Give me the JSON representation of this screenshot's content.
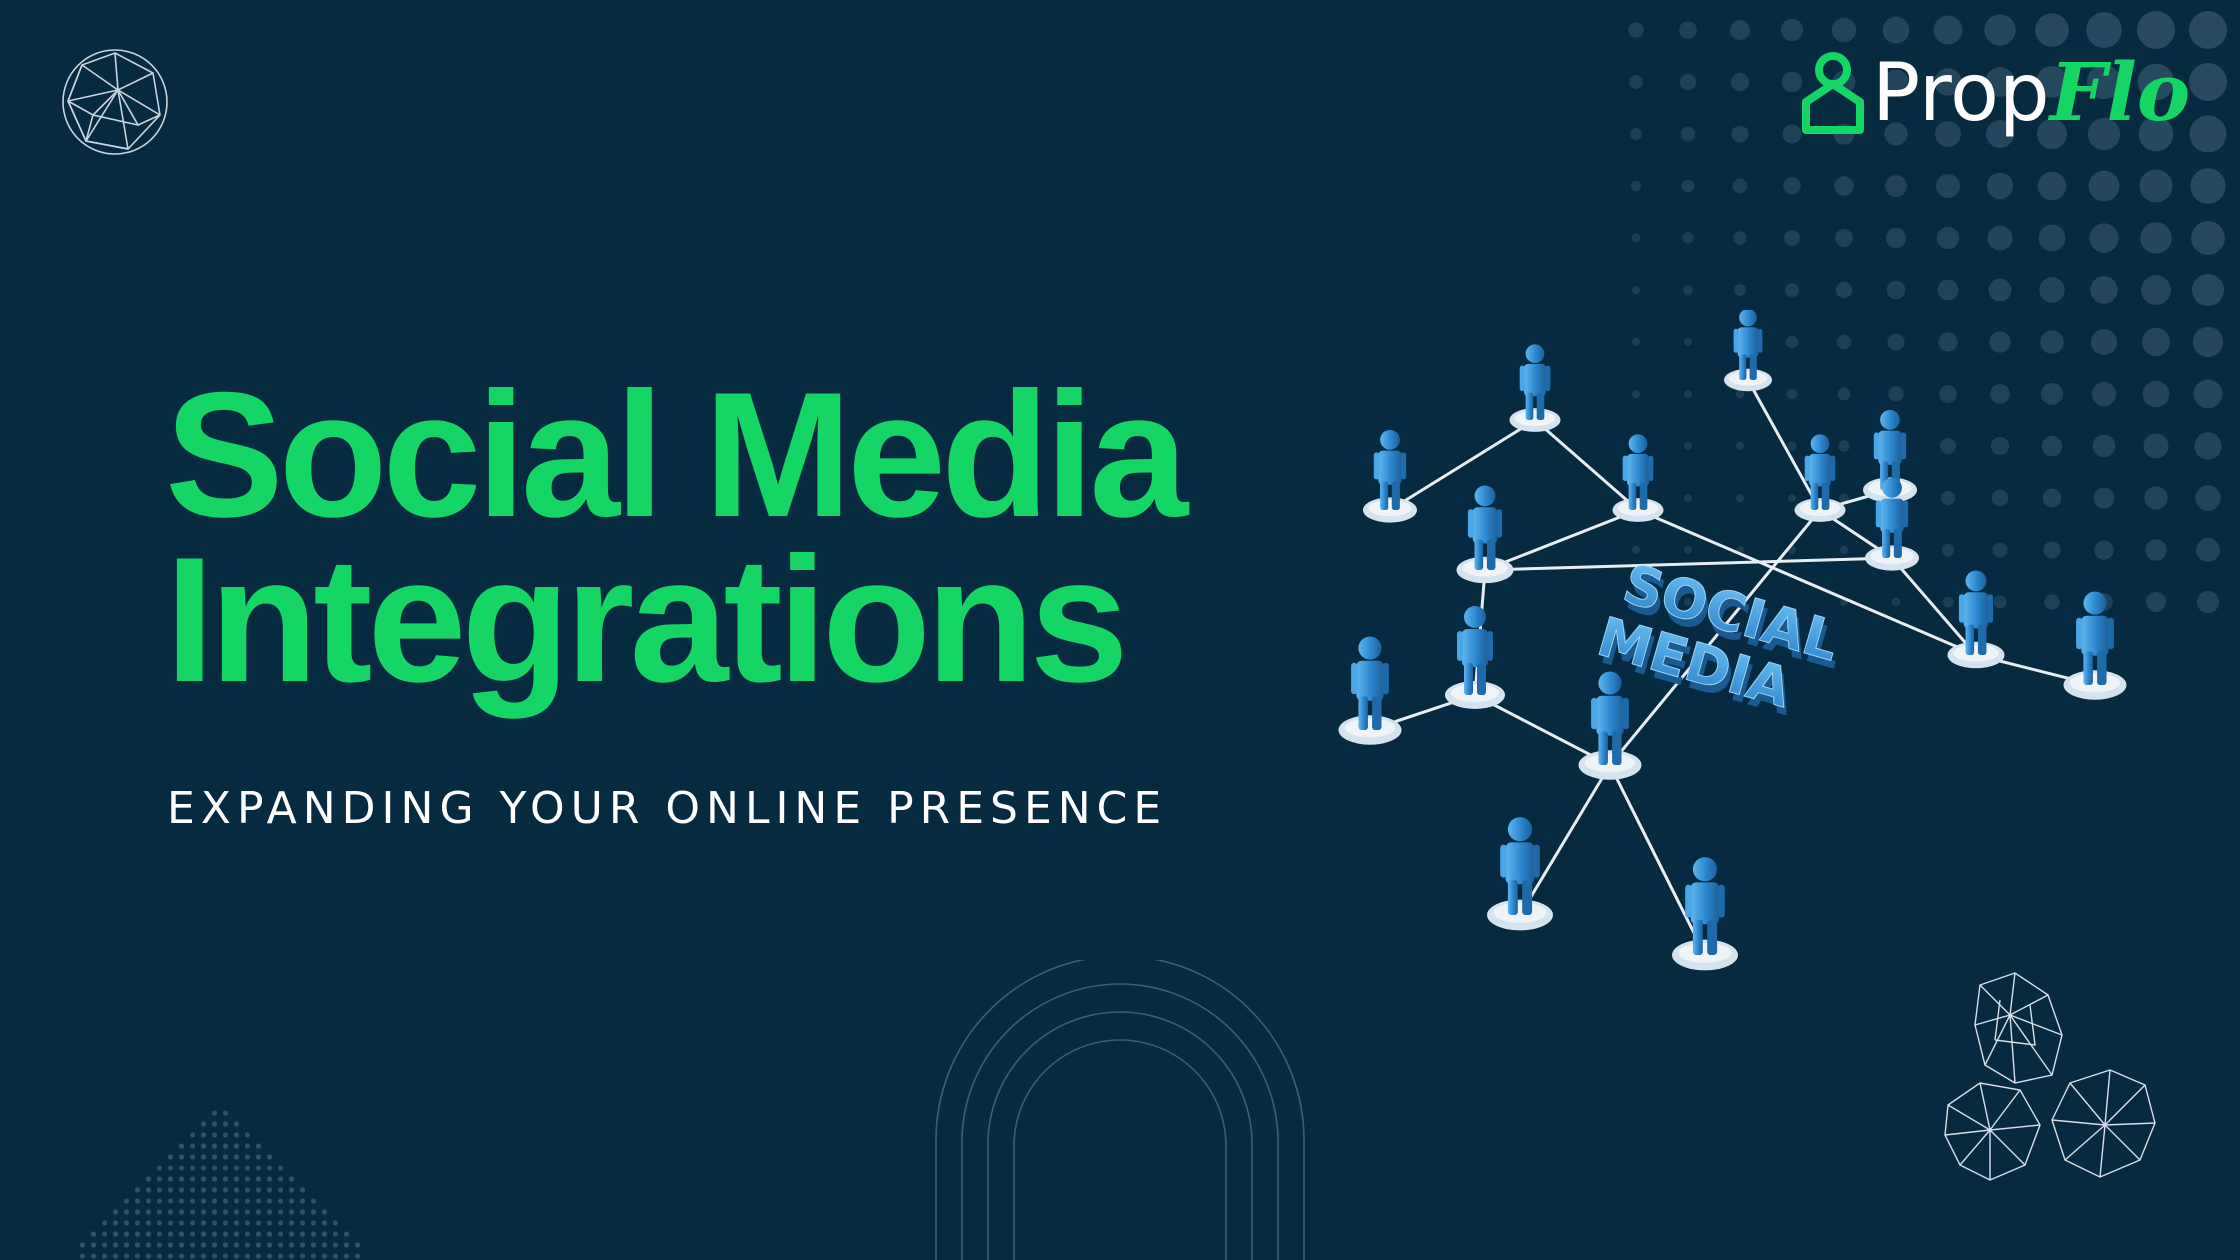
{
  "slide": {
    "title_line1": "Social Media",
    "title_line2": "Integrations",
    "subtitle": "EXPANDING YOUR ONLINE PRESENCE"
  },
  "logo": {
    "brand_part1": "Prop",
    "brand_part2": "Flo",
    "icon": "house-person-icon"
  },
  "illustration": {
    "label_line1": "SOCIAL",
    "label_line2": "MEDIA",
    "icon": "social-network-people-icon"
  },
  "colors": {
    "background": "#062a40",
    "accent": "#15d564",
    "figure_blue": "#2f8fd6",
    "text": "#ffffff"
  }
}
